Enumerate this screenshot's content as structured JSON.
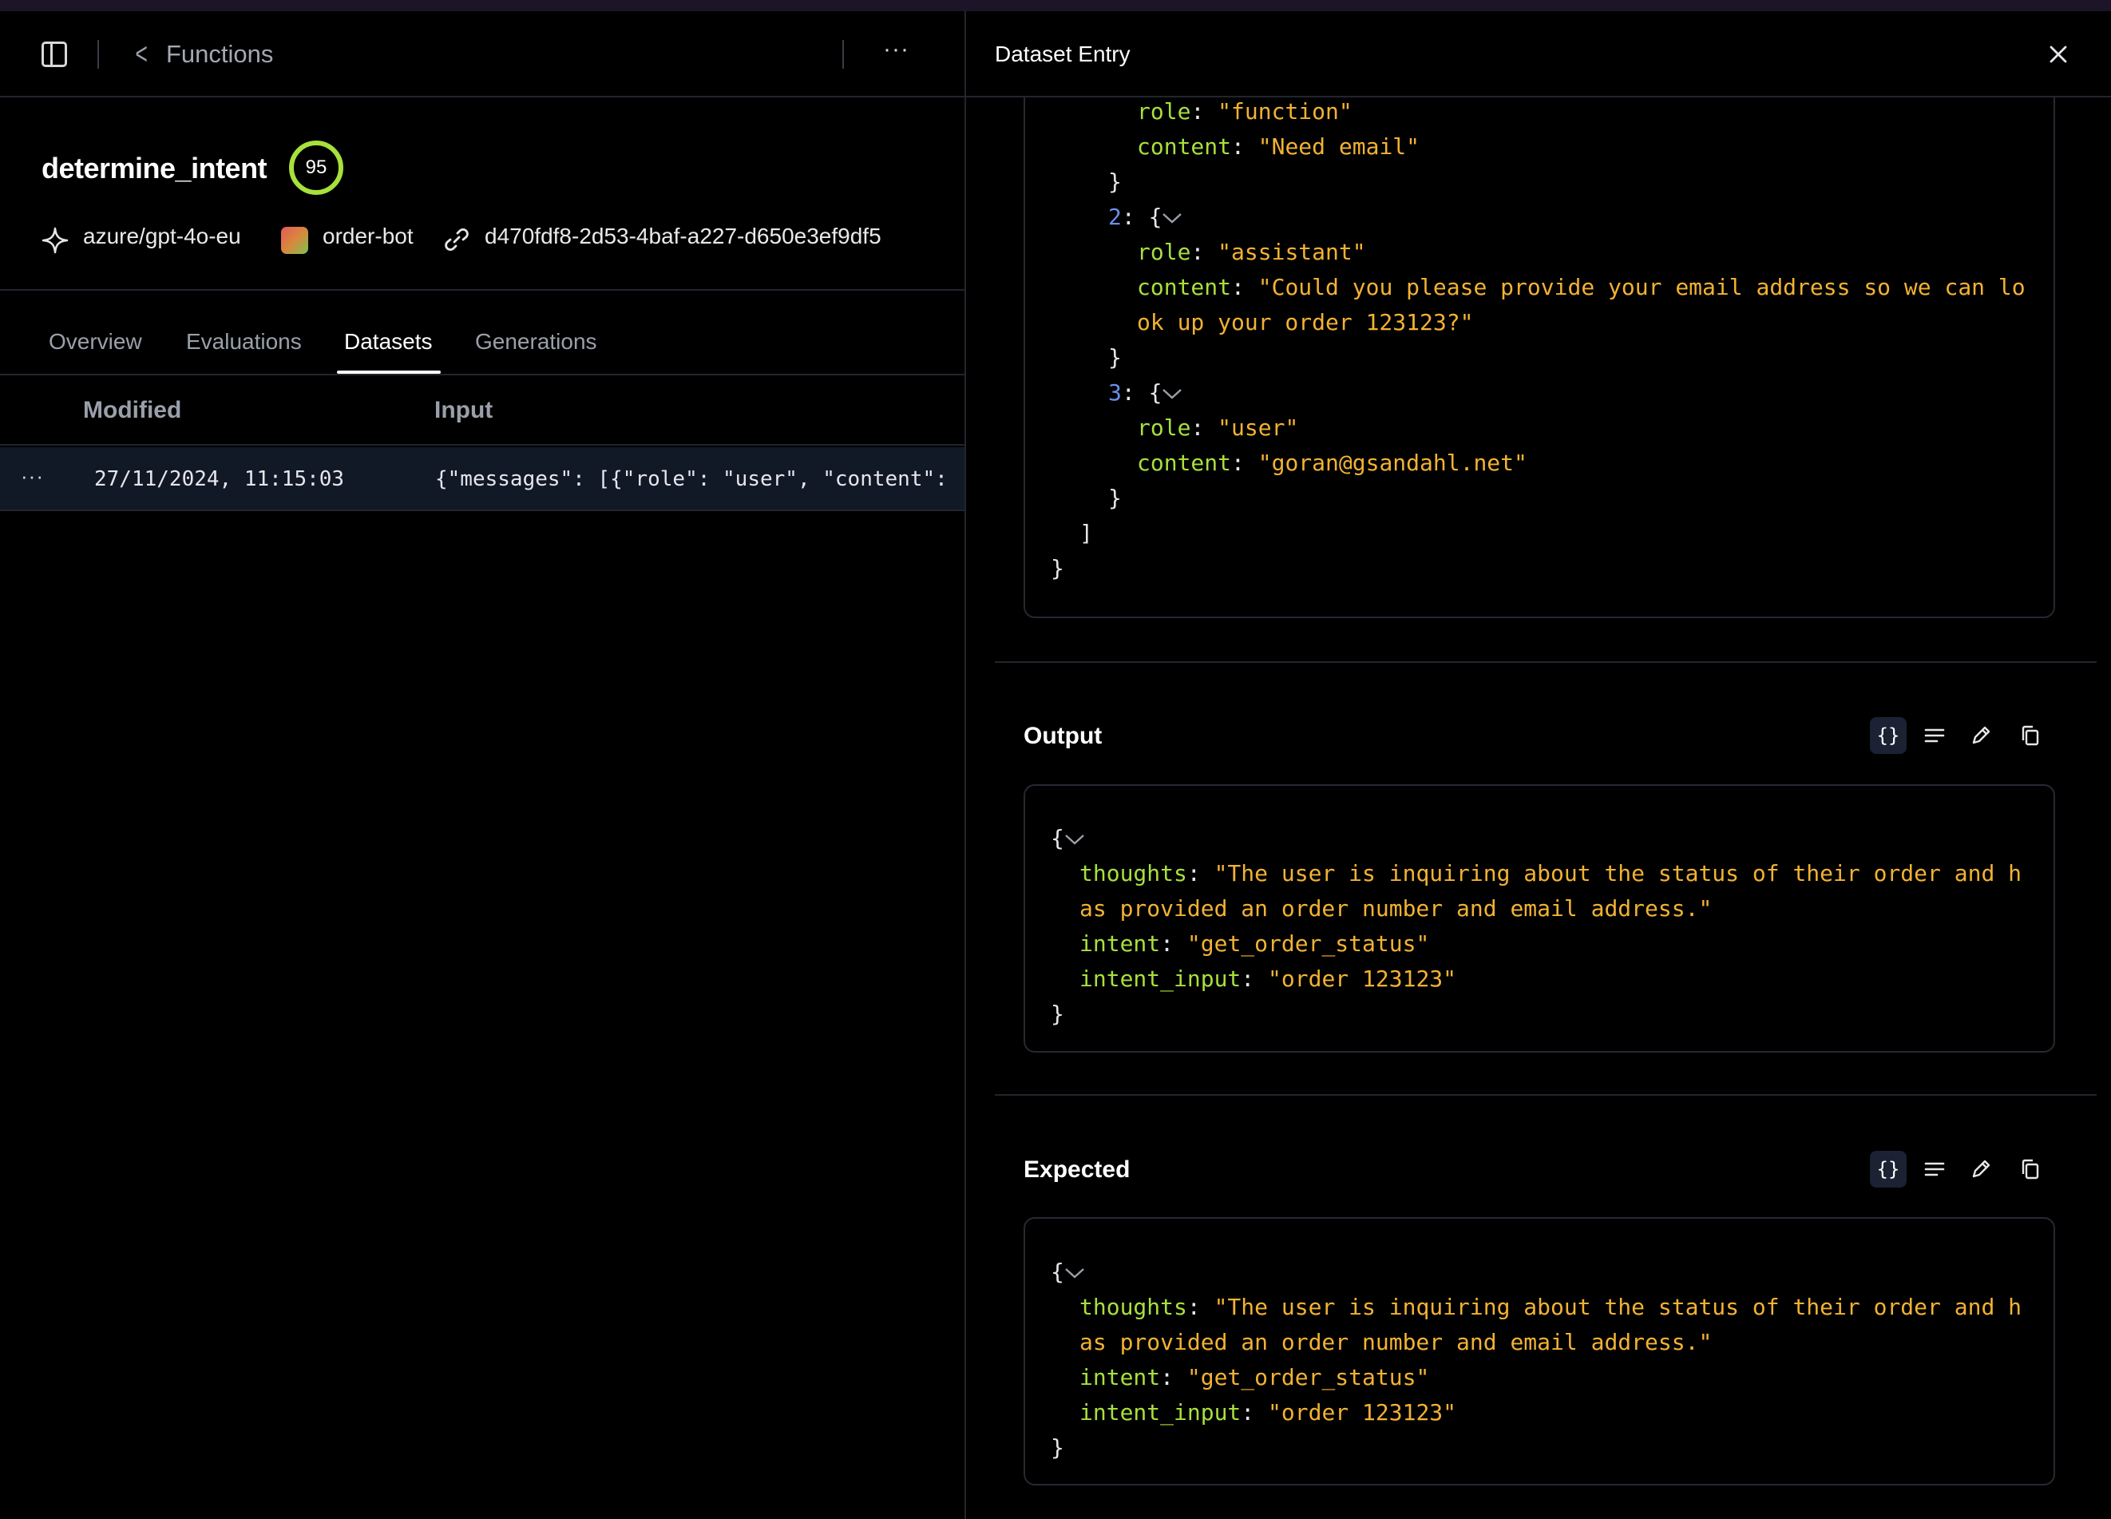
{
  "breadcrumb": {
    "label": "Functions"
  },
  "function": {
    "name": "determine_intent",
    "score": "95",
    "model": "azure/gpt-4o-eu",
    "bot": "order-bot",
    "id": "d470fdf8-2d53-4baf-a227-d650e3ef9df5"
  },
  "tabs": [
    {
      "label": "Overview"
    },
    {
      "label": "Evaluations"
    },
    {
      "label": "Datasets",
      "active": true
    },
    {
      "label": "Generations"
    }
  ],
  "table": {
    "columns": [
      "Modified",
      "Input"
    ],
    "rows": [
      {
        "modified": "27/11/2024, 11:15:03",
        "input": "{\"messages\": [{\"role\": \"user\", \"content\": \"I want to check the status of my order\"}]}"
      }
    ]
  },
  "panel": {
    "title": "Dataset Entry",
    "input_tail": {
      "m1_role_key": "role",
      "m1_role": "\"function\"",
      "m1_content_key": "content",
      "m1_content": "\"Need email\"",
      "m2_index": "2",
      "m2_role_key": "role",
      "m2_role": "\"assistant\"",
      "m2_content_key": "content",
      "m2_content_l1": "\"Could you please provide your email address so we can lo",
      "m2_content_l2": "ok up your order 123123?\"",
      "m3_index": "3",
      "m3_role_key": "role",
      "m3_role": "\"user\"",
      "m3_content_key": "content",
      "m3_content": "\"goran@gsandahl.net\""
    },
    "output": {
      "title": "Output",
      "thoughts_key": "thoughts",
      "thoughts_l1": "\"The user is inquiring about the status of their order and h",
      "thoughts_l2": "as provided an order number and email address.\"",
      "intent_key": "intent",
      "intent": "\"get_order_status\"",
      "intent_input_key": "intent_input",
      "intent_input": "\"order 123123\""
    },
    "expected": {
      "title": "Expected",
      "thoughts_key": "thoughts",
      "thoughts_l1": "\"The user is inquiring about the status of their order and h",
      "thoughts_l2": "as provided an order number and email address.\"",
      "intent_key": "intent",
      "intent": "\"get_order_status\"",
      "intent_input_key": "intent_input",
      "intent_input": "\"order 123123\""
    },
    "toolbar": {
      "json_label": "{}"
    }
  },
  "colors": {
    "key": "#a8e03c",
    "string": "#f2b233",
    "index": "#6b8ee8",
    "score_ring": "#a8e03c",
    "selected_row": "#111826"
  }
}
